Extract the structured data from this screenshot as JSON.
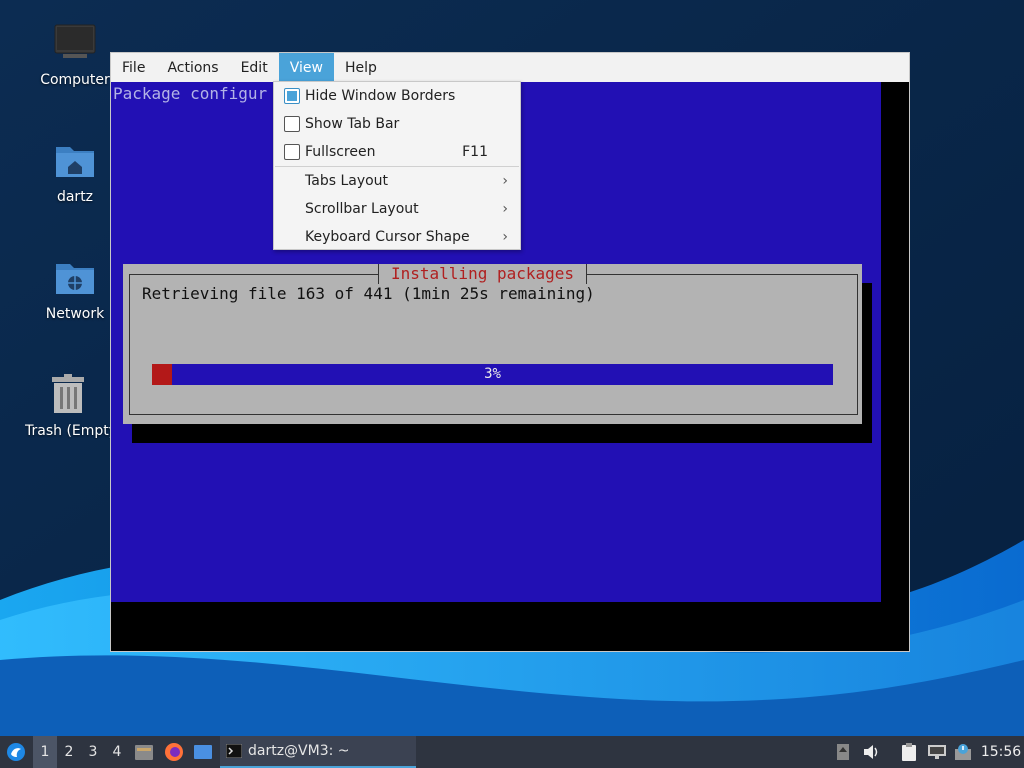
{
  "desktop": {
    "icons": [
      {
        "label": "Computer"
      },
      {
        "label": "dartz"
      },
      {
        "label": "Network"
      },
      {
        "label": "Trash (Empty)"
      }
    ]
  },
  "window": {
    "menubar": [
      "File",
      "Actions",
      "Edit",
      "View",
      "Help"
    ],
    "active_menu": "View"
  },
  "view_menu": {
    "checkbox_items": [
      {
        "label": "Hide Window Borders",
        "checked": true,
        "shortcut": ""
      },
      {
        "label": "Show Tab Bar",
        "checked": false,
        "shortcut": ""
      },
      {
        "label": "Fullscreen",
        "checked": false,
        "shortcut": "F11"
      }
    ],
    "submenu_items": [
      {
        "label": "Tabs Layout"
      },
      {
        "label": "Scrollbar Layout"
      },
      {
        "label": "Keyboard Cursor Shape"
      }
    ]
  },
  "terminal": {
    "header_text": "Package configur",
    "dialog": {
      "title": "Installing packages",
      "message": "Retrieving file 163 of 441 (1min 25s remaining)",
      "progress_percent": 3,
      "progress_label": "3%"
    }
  },
  "taskbar": {
    "workspaces": [
      "1",
      "2",
      "3",
      "4"
    ],
    "current_workspace": "1",
    "task_label": "dartz@VM3: ~",
    "clock": "15:56"
  },
  "colors": {
    "terminal_blue": "#2210b4",
    "dialog_gray": "#b3b3b3",
    "dialog_title_red": "#b02020",
    "progress_red": "#b31818",
    "menu_highlight": "#4aa3d9",
    "taskbar_bg": "#2e3440"
  }
}
